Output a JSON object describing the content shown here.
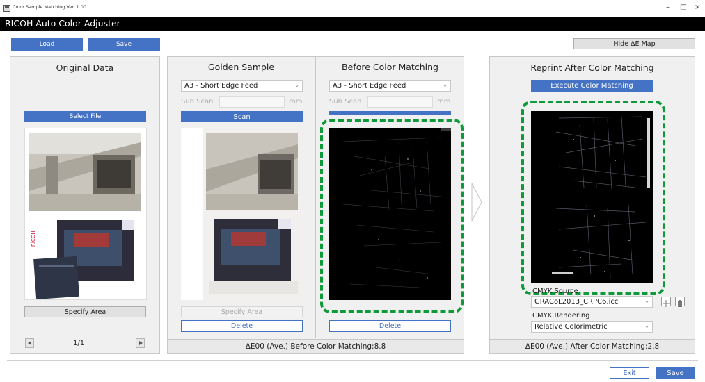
{
  "window": {
    "title": "Color Sample Matching Ver. 1.00",
    "controls": [
      "–",
      "□",
      "×"
    ]
  },
  "app": {
    "name": "RICOH Auto Color Adjuster"
  },
  "toolbar": {
    "load_label": "Load",
    "save_label": "Save",
    "hide_map_label": "Hide ΔE Map"
  },
  "original": {
    "title": "Original Data",
    "select_file_label": "Select File",
    "specify_area_label": "Specify Area",
    "page_indicator": "1/1"
  },
  "golden": {
    "title": "Golden Sample",
    "paper_select": "A3 - Short Edge Feed",
    "subscan_label": "Sub Scan",
    "unit": "mm",
    "scan_label": "Scan",
    "specify_area_label": "Specify Area",
    "delete_label": "Delete"
  },
  "before": {
    "title": "Before Color Matching",
    "paper_select": "A3 - Short Edge Feed",
    "subscan_label": "Sub Scan",
    "unit": "mm",
    "delete_label": "Delete"
  },
  "middle_footer": {
    "text": "ΔE00 (Ave.) Before Color Matching:8.8"
  },
  "reprint": {
    "title": "Reprint After Color Matching",
    "execute_label": "Execute Color Matching",
    "cmyk_source_label": "CMYK Source",
    "cmyk_source_value": "GRACoL2013_CRPC6.icc",
    "cmyk_rendering_label": "CMYK Rendering",
    "cmyk_rendering_value": "Relative Colorimetric",
    "footer_text": "ΔE00 (Ave.) After Color Matching:2.8"
  },
  "bottom": {
    "exit_label": "Exit",
    "save_label": "Save"
  },
  "colors": {
    "accent": "#4472c4",
    "highlight": "#0f9a3a",
    "header": "#000000"
  },
  "icons": [
    "app-icon",
    "chevron-down-icon",
    "arrow-right-icon",
    "plus-icon",
    "trash-icon",
    "prev-page-icon",
    "next-page-icon"
  ]
}
